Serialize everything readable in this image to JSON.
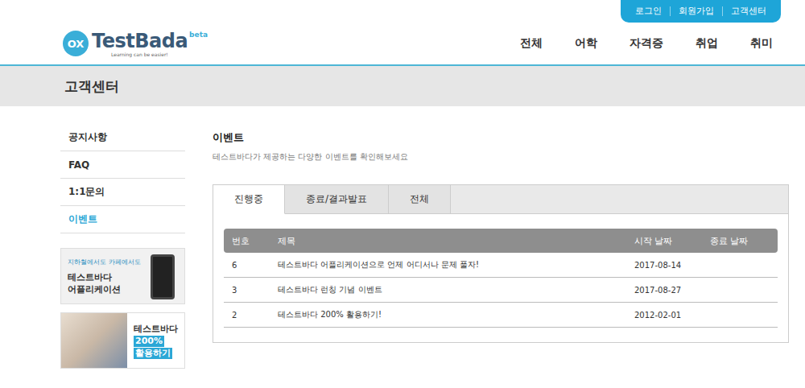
{
  "topbar": {
    "links": [
      "로그인",
      "회원가입",
      "고객센터"
    ]
  },
  "logo": {
    "mark": "OX",
    "name": "TestBada",
    "badge": "beta",
    "tagline": "Learning can be easier!"
  },
  "nav": {
    "items": [
      "전체",
      "어학",
      "자격증",
      "취업",
      "취미"
    ]
  },
  "page": {
    "title": "고객센터"
  },
  "sidebar": {
    "items": [
      {
        "label": "공지사항",
        "selected": false
      },
      {
        "label": "FAQ",
        "selected": false
      },
      {
        "label": "1:1문의",
        "selected": false
      },
      {
        "label": "이벤트",
        "selected": true
      }
    ],
    "banners": [
      {
        "kind": "app",
        "caption": "지하철에서도 카페에서도",
        "title": [
          "테스트바다",
          "어플리케이션"
        ],
        "highlights": []
      },
      {
        "kind": "guide",
        "caption": "",
        "title": [
          "테스트바다"
        ],
        "highlights": [
          "200%",
          "활용하기"
        ]
      }
    ]
  },
  "section": {
    "title": "이벤트",
    "subtitle": "테스트바다가 제공하는 다양한 이벤트를 확인해보세요"
  },
  "tabs": [
    {
      "label": "진행중",
      "selected": true
    },
    {
      "label": "종료/결과발표",
      "selected": false
    },
    {
      "label": "전체",
      "selected": false
    }
  ],
  "table": {
    "columns": [
      "번호",
      "제목",
      "시작 날짜",
      "종료 날짜"
    ],
    "rows": [
      [
        "6",
        "테스트바다 어플리케이션으로 언제 어디서나 문제 풀자!",
        "2017-08-14",
        ""
      ],
      [
        "3",
        "테스트바다 런칭 기념 이벤트",
        "2017-08-27",
        ""
      ],
      [
        "2",
        "테스트바다 200% 활용하기!",
        "2012-02-01",
        ""
      ]
    ]
  }
}
